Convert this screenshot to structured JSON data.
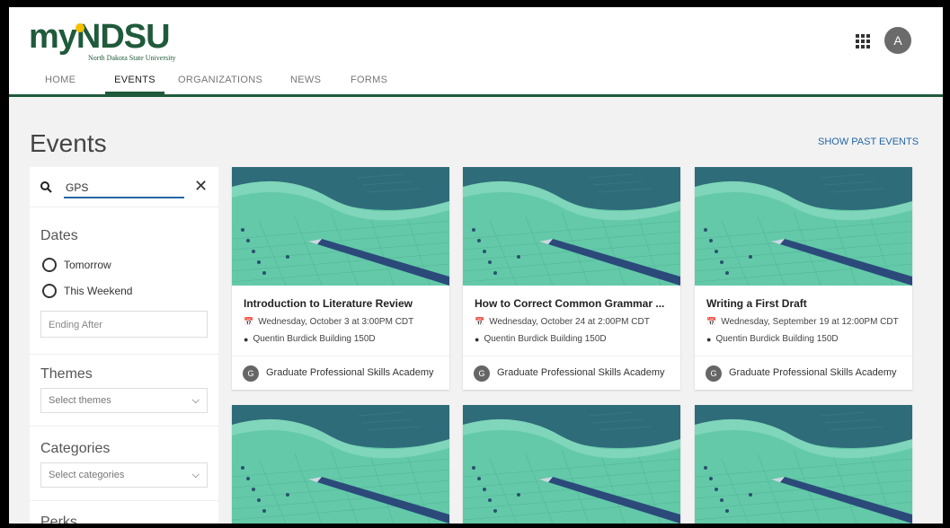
{
  "brand": {
    "logo_text_my": "my",
    "logo_text_ndsu": "NDSU",
    "logo_sub": "North Dakota State University",
    "accent": "#1f5a3b",
    "gold": "#f5c000",
    "link": "#2466a7"
  },
  "header": {
    "apps_icon": "apps-grid-icon",
    "avatar_initial": "A"
  },
  "nav": {
    "tabs": [
      {
        "label": "HOME",
        "active": false
      },
      {
        "label": "EVENTS",
        "active": true
      },
      {
        "label": "ORGANIZATIONS",
        "active": false
      },
      {
        "label": "NEWS",
        "active": false
      },
      {
        "label": "FORMS",
        "active": false
      }
    ]
  },
  "page": {
    "title": "Events",
    "show_past": "SHOW PAST EVENTS"
  },
  "filters": {
    "search_value": "GPS",
    "dates_title": "Dates",
    "date_options": [
      "Tomorrow",
      "This Weekend"
    ],
    "ending_after_placeholder": "Ending After",
    "themes_title": "Themes",
    "themes_placeholder": "Select themes",
    "categories_title": "Categories",
    "categories_placeholder": "Select categories",
    "perks_title": "Perks"
  },
  "events": [
    {
      "title": "Introduction to Literature Review",
      "date": "Wednesday, October 3 at 3:00PM CDT",
      "location": "Quentin Burdick Building 150D",
      "org_initial": "G",
      "org": "Graduate Professional Skills Academy"
    },
    {
      "title": "How to Correct Common Grammar ...",
      "date": "Wednesday, October 24 at 2:00PM CDT",
      "location": "Quentin Burdick Building 150D",
      "org_initial": "G",
      "org": "Graduate Professional Skills Academy"
    },
    {
      "title": "Writing a First Draft",
      "date": "Wednesday, September 19 at 12:00PM CDT",
      "location": "Quentin Burdick Building 150D",
      "org_initial": "G",
      "org": "Graduate Professional Skills Academy"
    }
  ]
}
